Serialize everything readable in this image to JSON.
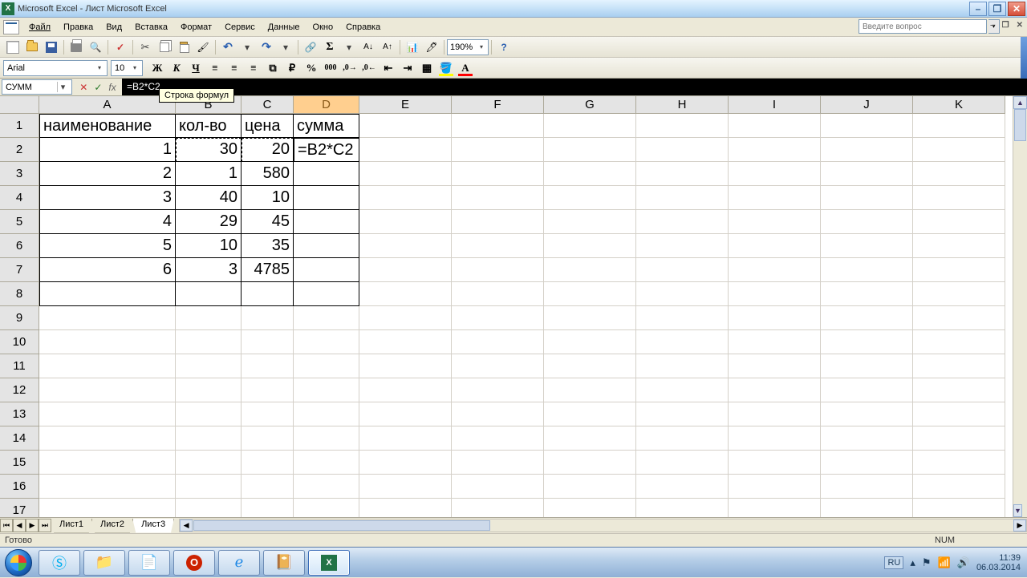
{
  "title": "Microsoft Excel - Лист Microsoft Excel",
  "menu": [
    "Файл",
    "Правка",
    "Вид",
    "Вставка",
    "Формат",
    "Сервис",
    "Данные",
    "Окно",
    "Справка"
  ],
  "question_placeholder": "Введите вопрос",
  "toolbar": {
    "zoom": "190%"
  },
  "formatbar": {
    "font": "Arial",
    "size": "10",
    "bold": "Ж",
    "italic": "К",
    "underline": "Ч"
  },
  "namebox": "СУММ",
  "formula": "=B2*C2",
  "tooltip_formula_bar": "Строка формул",
  "columns": [
    "A",
    "B",
    "C",
    "D",
    "E",
    "F",
    "G",
    "H",
    "I",
    "J",
    "K"
  ],
  "selected_col": "D",
  "row_count": 17,
  "headers": {
    "A": "наименование",
    "B": "кол-во",
    "C": "цена",
    "D": "сумма"
  },
  "editing_cell_text": "=B2*C2",
  "rows": [
    {
      "A": "1",
      "B": "30",
      "C": "20",
      "D_editing": true
    },
    {
      "A": "2",
      "B": "1",
      "C": "580"
    },
    {
      "A": "3",
      "B": "40",
      "C": "10"
    },
    {
      "A": "4",
      "B": "29",
      "C": "45"
    },
    {
      "A": "5",
      "B": "10",
      "C": "35"
    },
    {
      "A": "6",
      "B": "3",
      "C": "4785"
    }
  ],
  "sheets": [
    "Лист1",
    "Лист2",
    "Лист3"
  ],
  "active_sheet": 2,
  "status": {
    "left": "Готово",
    "num": "NUM"
  },
  "tray": {
    "lang": "RU",
    "time": "11:39",
    "date": "06.03.2014"
  }
}
